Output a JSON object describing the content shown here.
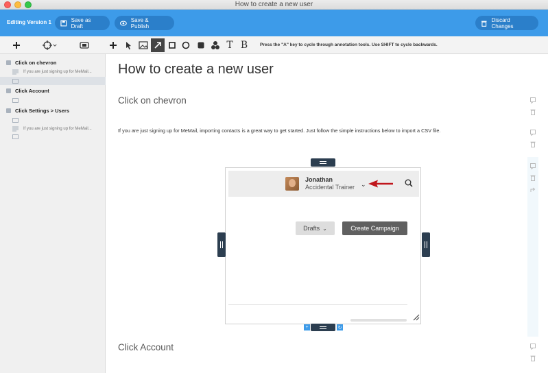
{
  "window": {
    "title": "How to create a new user"
  },
  "header": {
    "editing_label": "Editing Version 1",
    "save_draft": "Save as Draft",
    "save_publish": "Save & Publish",
    "discard": "Discard Changes",
    "accent_color": "#3d9be9"
  },
  "toolbar": {
    "tools": [
      "add-icon",
      "target-icon",
      "screen-capture-icon",
      "add-icon",
      "cursor-icon",
      "image-icon",
      "arrow-icon",
      "rectangle-icon",
      "circle-icon",
      "blur-icon",
      "steps-icon",
      "text-icon",
      "bold-text-icon"
    ],
    "active_tool": "arrow-icon",
    "hint": "Press the \"A\" key to cycle through annotation tools. Use SHIFT to cycle backwards."
  },
  "sidebar": {
    "steps": [
      {
        "title": "Click on chevron",
        "sub": "If you are just signing up for MeMail..."
      },
      {
        "title": "Click Account"
      },
      {
        "title": "Click Settings > Users",
        "sub": "If you are just signing up for MeMail..."
      }
    ]
  },
  "main": {
    "page_title": "How to create a new user",
    "step1_heading": "Click on chevron",
    "step1_desc": "If you are just signing up for MeMail, importing contacts is a great way to get started. Just follow the simple instructions below to import a CSV file.",
    "step2_heading": "Click Account"
  },
  "screenshot": {
    "user_name": "Jonathan",
    "user_role": "Accidental Trainer",
    "drafts_label": "Drafts",
    "create_label": "Create Campaign",
    "arrow_color": "#c0161d"
  }
}
